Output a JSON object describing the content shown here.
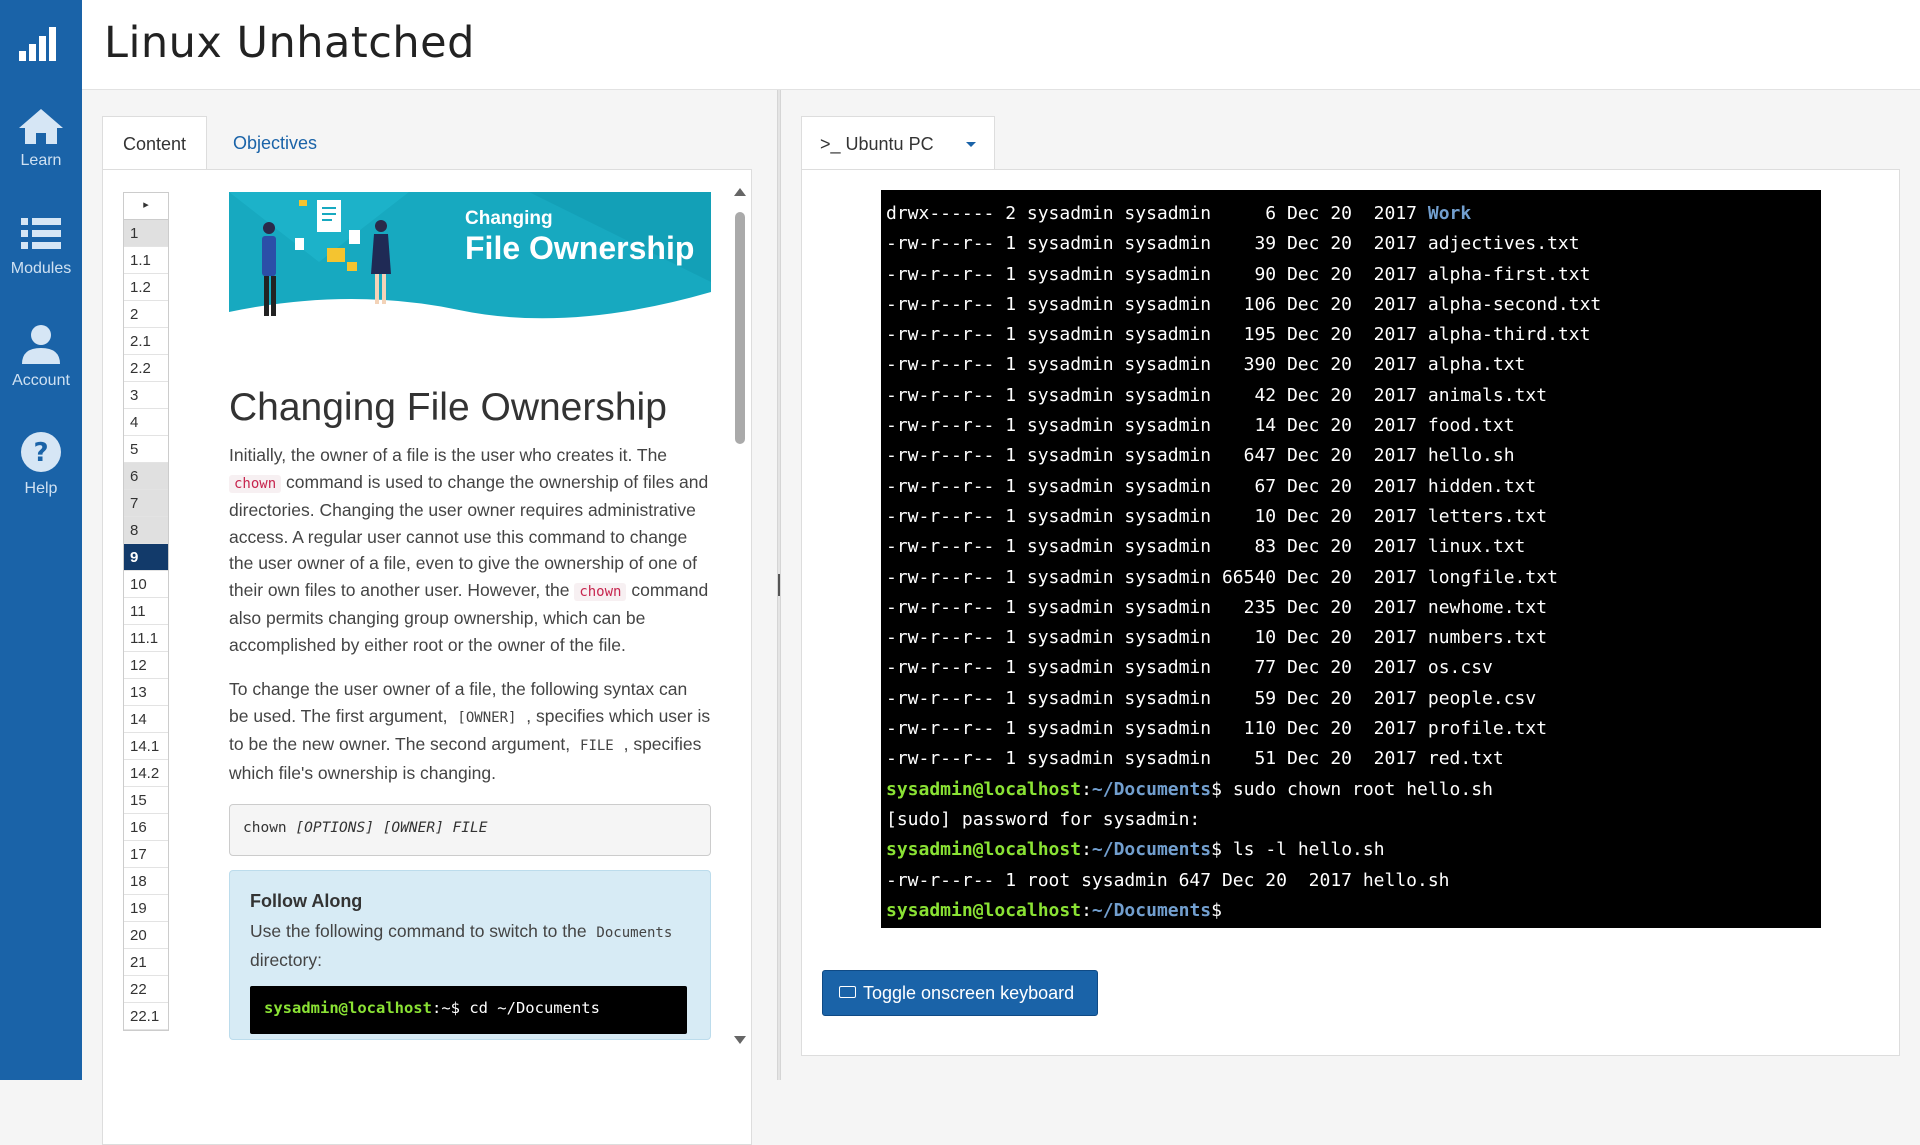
{
  "app": {
    "title": "Linux Unhatched"
  },
  "nav": {
    "items": [
      {
        "label": "Learn",
        "icon": "home-icon"
      },
      {
        "label": "Modules",
        "icon": "list-icon"
      },
      {
        "label": "Account",
        "icon": "user-icon"
      },
      {
        "label": "Help",
        "icon": "help-icon"
      }
    ]
  },
  "left_tabs": {
    "content": "Content",
    "objectives": "Objectives"
  },
  "toc": {
    "items": [
      "1",
      "1.1",
      "1.2",
      "2",
      "2.1",
      "2.2",
      "3",
      "4",
      "5",
      "6",
      "7",
      "8",
      "9",
      "10",
      "11",
      "11.1",
      "12",
      "13",
      "14",
      "14.1",
      "14.2",
      "15",
      "16",
      "17",
      "18",
      "19",
      "20",
      "21",
      "22",
      "22.1"
    ],
    "visited": [
      "1",
      "6",
      "7",
      "8"
    ],
    "current": "9"
  },
  "banner": {
    "line1": "Changing",
    "line2": "File Ownership"
  },
  "article": {
    "heading": "Changing File Ownership",
    "p1_a": "Initially, the owner of a file is the user who creates it. The ",
    "p1_code1": "chown",
    "p1_b": " command is used to change the ownership of files and directories. Changing the user owner requires administrative access. A regular user cannot use this command to change the user owner of a file, even to give the ownership of one of their own files to another user. However, the ",
    "p1_code2": "chown",
    "p1_c": " command also permits changing group ownership, which can be accomplished by either root or the owner of the file.",
    "p2_a": "To change the user owner of a file, the following syntax can be used. The first argument, ",
    "p2_code1": "[OWNER]",
    "p2_b": " , specifies which user is to be the new owner. The second argument, ",
    "p2_code2": "FILE",
    "p2_c": " , specifies which file's ownership is changing.",
    "syntax_cmd": "chown ",
    "syntax_opt": "[OPTIONS]",
    "syntax_owner": "[OWNER]",
    "syntax_file": "FILE",
    "follow_title": "Follow Along",
    "follow_text_a": "Use the following command to switch to the ",
    "follow_code": "Documents",
    "follow_text_b": " directory:",
    "follow_prompt": "sysadmin@localhost",
    "follow_sep": ":~$",
    "follow_cmd": " cd ~/Documents"
  },
  "vm": {
    "tab_label": ">_ Ubuntu PC"
  },
  "terminal": {
    "listing": [
      {
        "meta": "drwx------ 2 sysadmin sysadmin     6 Dec 20  2017 ",
        "name": "Work",
        "dir": true
      },
      {
        "meta": "-rw-r--r-- 1 sysadmin sysadmin    39 Dec 20  2017 ",
        "name": "adjectives.txt"
      },
      {
        "meta": "-rw-r--r-- 1 sysadmin sysadmin    90 Dec 20  2017 ",
        "name": "alpha-first.txt"
      },
      {
        "meta": "-rw-r--r-- 1 sysadmin sysadmin   106 Dec 20  2017 ",
        "name": "alpha-second.txt"
      },
      {
        "meta": "-rw-r--r-- 1 sysadmin sysadmin   195 Dec 20  2017 ",
        "name": "alpha-third.txt"
      },
      {
        "meta": "-rw-r--r-- 1 sysadmin sysadmin   390 Dec 20  2017 ",
        "name": "alpha.txt"
      },
      {
        "meta": "-rw-r--r-- 1 sysadmin sysadmin    42 Dec 20  2017 ",
        "name": "animals.txt"
      },
      {
        "meta": "-rw-r--r-- 1 sysadmin sysadmin    14 Dec 20  2017 ",
        "name": "food.txt"
      },
      {
        "meta": "-rw-r--r-- 1 sysadmin sysadmin   647 Dec 20  2017 ",
        "name": "hello.sh"
      },
      {
        "meta": "-rw-r--r-- 1 sysadmin sysadmin    67 Dec 20  2017 ",
        "name": "hidden.txt"
      },
      {
        "meta": "-rw-r--r-- 1 sysadmin sysadmin    10 Dec 20  2017 ",
        "name": "letters.txt"
      },
      {
        "meta": "-rw-r--r-- 1 sysadmin sysadmin    83 Dec 20  2017 ",
        "name": "linux.txt"
      },
      {
        "meta": "-rw-r--r-- 1 sysadmin sysadmin 66540 Dec 20  2017 ",
        "name": "longfile.txt"
      },
      {
        "meta": "-rw-r--r-- 1 sysadmin sysadmin   235 Dec 20  2017 ",
        "name": "newhome.txt"
      },
      {
        "meta": "-rw-r--r-- 1 sysadmin sysadmin    10 Dec 20  2017 ",
        "name": "numbers.txt"
      },
      {
        "meta": "-rw-r--r-- 1 sysadmin sysadmin    77 Dec 20  2017 ",
        "name": "os.csv"
      },
      {
        "meta": "-rw-r--r-- 1 sysadmin sysadmin    59 Dec 20  2017 ",
        "name": "people.csv"
      },
      {
        "meta": "-rw-r--r-- 1 sysadmin sysadmin   110 Dec 20  2017 ",
        "name": "profile.txt"
      },
      {
        "meta": "-rw-r--r-- 1 sysadmin sysadmin    51 Dec 20  2017 ",
        "name": "red.txt"
      }
    ],
    "prompt_user": "sysadmin@localhost",
    "prompt_colon": ":",
    "prompt_path": "~/Documents",
    "prompt_dollar": "$",
    "cmd1": " sudo chown root hello.sh",
    "sudo_line": "[sudo] password for sysadmin:",
    "cmd2": " ls -l hello.sh",
    "result_line": "-rw-r--r-- 1 root sysadmin 647 Dec 20  2017 hello.sh"
  },
  "keyboard_button": "Toggle onscreen keyboard",
  "colors": {
    "rail": "#1a63a8",
    "toc_current": "#123a6a",
    "prompt_green": "#8ae234",
    "dir_blue": "#729fcf",
    "banner_teal": "#1bb3c8"
  }
}
